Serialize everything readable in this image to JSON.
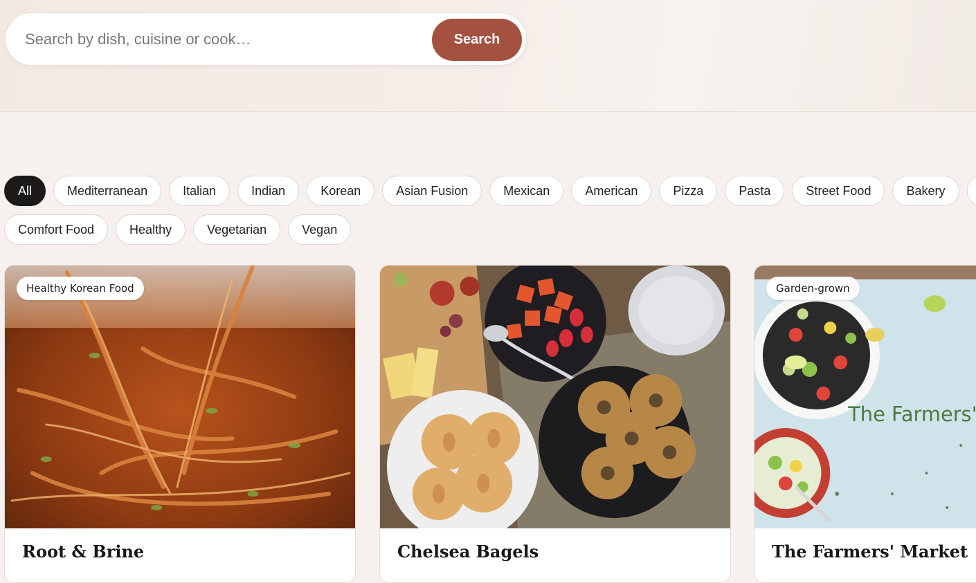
{
  "search": {
    "placeholder": "Search by dish, cuisine or cook…",
    "value": "",
    "button_label": "Search",
    "button_color": "#a4513f"
  },
  "filters": {
    "selected": "All",
    "row1": [
      {
        "label": "All",
        "active": true
      },
      {
        "label": "Mediterranean"
      },
      {
        "label": "Italian"
      },
      {
        "label": "Indian"
      },
      {
        "label": "Korean"
      },
      {
        "label": "Asian Fusion"
      },
      {
        "label": "Mexican"
      },
      {
        "label": "American"
      },
      {
        "label": "Pizza"
      },
      {
        "label": "Pasta"
      },
      {
        "label": "Street Food"
      },
      {
        "label": "Bakery"
      },
      {
        "label": ""
      }
    ],
    "row2": [
      {
        "label": "Comfort Food"
      },
      {
        "label": "Healthy"
      },
      {
        "label": "Vegetarian"
      },
      {
        "label": "Vegan"
      }
    ]
  },
  "cards": [
    {
      "badge": "Healthy Korean Food",
      "title": "Root & Brine",
      "image": "stir-fried noodles being lifted with chopsticks"
    },
    {
      "badge": "",
      "title": "Chelsea Bagels",
      "image": "bagels, strawberries, cheese and charcuterie on a wooden table"
    },
    {
      "badge": "Garden-grown",
      "title": "The Farmers' Market",
      "image_text": "The Farmers'",
      "image": "colorful salads on a light blue surface"
    }
  ]
}
